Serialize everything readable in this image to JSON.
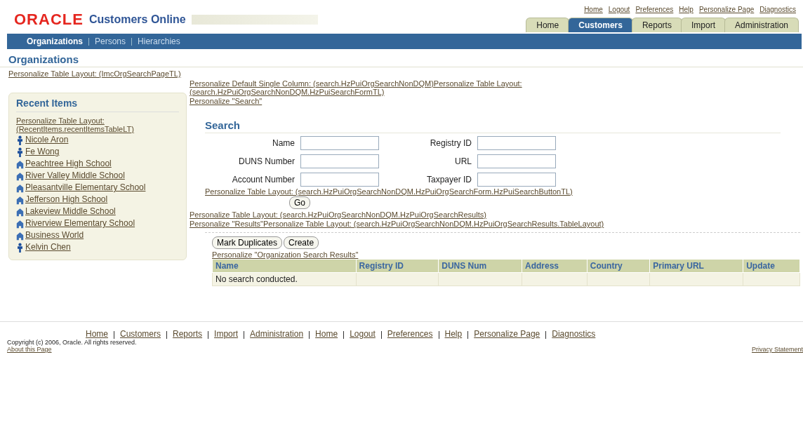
{
  "brand": {
    "logo": "ORACLE",
    "product": "Customers Online"
  },
  "global_links": [
    "Home",
    "Logout",
    "Preferences",
    "Help",
    "Personalize Page",
    "Diagnostics"
  ],
  "tabs": [
    {
      "label": "Home",
      "selected": false
    },
    {
      "label": "Customers",
      "selected": true
    },
    {
      "label": "Reports",
      "selected": false
    },
    {
      "label": "Import",
      "selected": false
    },
    {
      "label": "Administration",
      "selected": false
    }
  ],
  "subnav": [
    {
      "label": "Organizations",
      "selected": true
    },
    {
      "label": "Persons",
      "selected": false
    },
    {
      "label": "Hierarchies",
      "selected": false
    }
  ],
  "page_title": "Organizations",
  "page_personalize": "Personalize Table Layout: (ImcOrgSearchPageTL)",
  "recent_items": {
    "title": "Recent Items",
    "personalize": "Personalize Table Layout: (RecentItems.recentItemsTableLT)",
    "items": [
      {
        "kind": "person",
        "label": "Nicole Aron"
      },
      {
        "kind": "person",
        "label": "Fe Wong"
      },
      {
        "kind": "organization",
        "label": "Peachtree High School"
      },
      {
        "kind": "organization",
        "label": "River Valley Middle School"
      },
      {
        "kind": "organization",
        "label": "Pleasantville Elementary School"
      },
      {
        "kind": "organization",
        "label": "Jefferson High School"
      },
      {
        "kind": "organization",
        "label": "Lakeview Middle School"
      },
      {
        "kind": "organization",
        "label": "Riverview Elementary School"
      },
      {
        "kind": "organization",
        "label": "Business World"
      },
      {
        "kind": "person",
        "label": "Kelvin Chen"
      }
    ]
  },
  "personalize_top": [
    "Personalize Default Single Column: (search.HzPuiOrgSearchNonDQM)Personalize Table Layout: (search.HzPuiOrgSearchNonDQM.HzPuiSearchFormTL)",
    "Personalize \"Search\""
  ],
  "search": {
    "title": "Search",
    "fields": [
      {
        "label": "Name"
      },
      {
        "label": "Registry ID"
      },
      {
        "label": "DUNS Number"
      },
      {
        "label": "URL"
      },
      {
        "label": "Account Number"
      },
      {
        "label": "Taxpayer ID"
      }
    ],
    "personalize": "Personalize Table Layout: (search.HzPuiOrgSearchNonDQM.HzPuiOrgSearchForm.HzPuiSearchButtonTL)",
    "go_button": "Go"
  },
  "personalize_results": [
    "Personalize Table Layout: (search.HzPuiOrgSearchNonDQM.HzPuiOrgSearchResults)",
    "Personalize \"Results\"Personalize Table Layout: (search.HzPuiOrgSearchNonDQM.HzPuiOrgSearchResults.TableLayout)"
  ],
  "results": {
    "buttons": [
      "Mark Duplicates",
      "Create"
    ],
    "personalize": "Personalize \"Organization Search Results\"",
    "columns": [
      "Name",
      "Registry ID",
      "DUNS Num",
      "Address",
      "Country",
      "Primary URL",
      "Update"
    ],
    "empty_message": "No search conducted."
  },
  "footer": {
    "links": [
      "Home",
      "Customers",
      "Reports",
      "Import",
      "Administration",
      "Home",
      "Logout",
      "Preferences",
      "Help",
      "Personalize Page",
      "Diagnostics"
    ],
    "copyright": "Copyright (c) 2006, Oracle. All rights reserved.",
    "about": "About this Page",
    "privacy": "Privacy Statement"
  }
}
